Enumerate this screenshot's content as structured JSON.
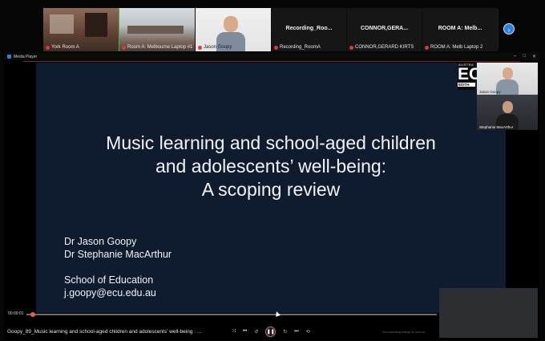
{
  "participants": {
    "video_tiles": [
      {
        "label": "York Room A",
        "active": true
      },
      {
        "label": "Room A: Melbourne Laptop #1",
        "active": false
      },
      {
        "label": "Jason Goopy",
        "active": false
      }
    ],
    "name_tiles": [
      {
        "title": "Recording_Roo...",
        "label": "Recording_RoomA"
      },
      {
        "title": "CONNOR,GERA...",
        "label": "CONNOR,GERARD KIRTS"
      },
      {
        "title": "ROOM A: Melb...",
        "label": "ROOM A: Melb Laptop 2"
      }
    ],
    "next_icon": "chevron-right-icon"
  },
  "player": {
    "window_title": "Media Player",
    "file_title": "Goopy_89_Music learning and school-aged children and adolescents' well-being : ...",
    "elapsed": "00:00:01",
    "progress": 0.01,
    "status_text": "Not requesting change for your ca..."
  },
  "slide": {
    "title_lines": [
      "Music learning and school-aged children",
      "and adolescents’ well-being:",
      "A scoping review"
    ],
    "authors": [
      "Dr Jason Goopy",
      "Dr Stephanie MacArthur"
    ],
    "affiliation": "School of Education",
    "email": "j.goopy@ecu.edu.au",
    "logo": {
      "top": "AUSTRA",
      "main": "EC",
      "bottom": "EDITH"
    }
  },
  "presenter_cams": [
    {
      "label": "Jason Goopy"
    },
    {
      "label": "Stephanie MacArthur"
    }
  ],
  "colors": {
    "accent": "#2d7fe0",
    "active_border": "#3fb24a",
    "slide_bg": "#0f1b2e"
  }
}
